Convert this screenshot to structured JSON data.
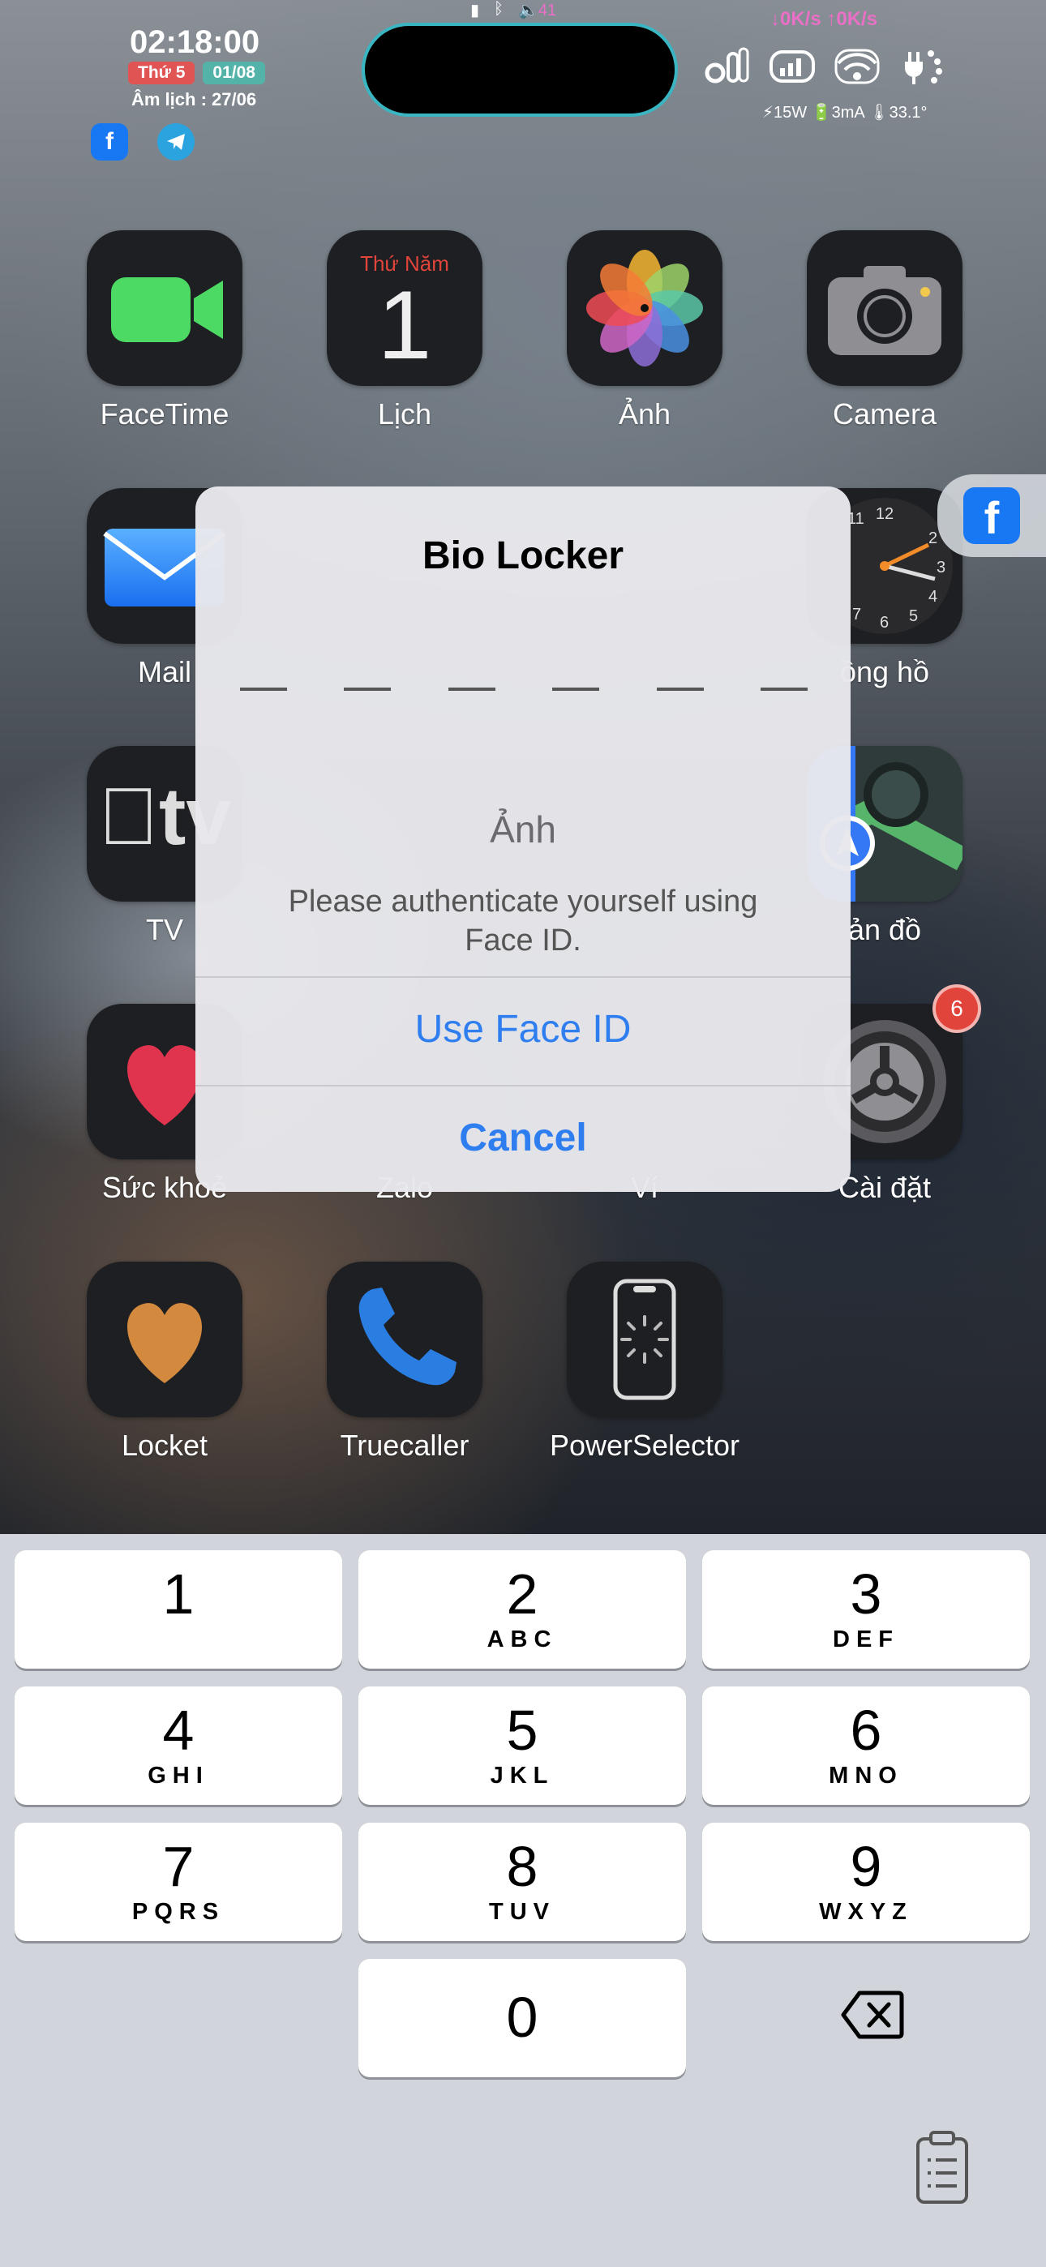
{
  "status_bar": {
    "time": "02:18:00",
    "day": "Thứ 5",
    "date": "01/08",
    "lunar": "Âm lịch : 27/06",
    "volume": "41",
    "net_speed": "↓0K/s ↑0K/s",
    "power_info": "⚡15W 🔋3mA 🌡33.1°"
  },
  "home_apps": {
    "facetime": "FaceTime",
    "calendar": "Lịch",
    "calendar_day": "Thứ Năm",
    "calendar_date": "1",
    "photos": "Ảnh",
    "camera": "Camera",
    "mail": "Mail",
    "clock": "ồng hồ",
    "tv": "TV",
    "maps": "ản đồ",
    "health": "Sức khoẻ",
    "zalo": "Zalo",
    "vi": "Ví",
    "settings": "Cài đặt",
    "settings_badge": "6",
    "locket": "Locket",
    "truecaller": "Truecaller",
    "powerselector": "PowerSelector"
  },
  "dialog": {
    "title": "Bio Locker",
    "pin_length": 6,
    "app_name": "Ảnh",
    "message": "Please authenticate yourself using Face ID.",
    "use_face_id": "Use Face ID",
    "cancel": "Cancel"
  },
  "keypad": {
    "keys": [
      {
        "num": "1",
        "letters": ""
      },
      {
        "num": "2",
        "letters": "ABC"
      },
      {
        "num": "3",
        "letters": "DEF"
      },
      {
        "num": "4",
        "letters": "GHI"
      },
      {
        "num": "5",
        "letters": "JKL"
      },
      {
        "num": "6",
        "letters": "MNO"
      },
      {
        "num": "7",
        "letters": "PQRS"
      },
      {
        "num": "8",
        "letters": "TUV"
      },
      {
        "num": "9",
        "letters": "WXYZ"
      },
      {
        "num": "0",
        "letters": ""
      }
    ]
  },
  "colors": {
    "accent_blue": "#2f7ef0",
    "badge_red": "#e0443a",
    "keyboard_bg": "#d1d4da"
  }
}
